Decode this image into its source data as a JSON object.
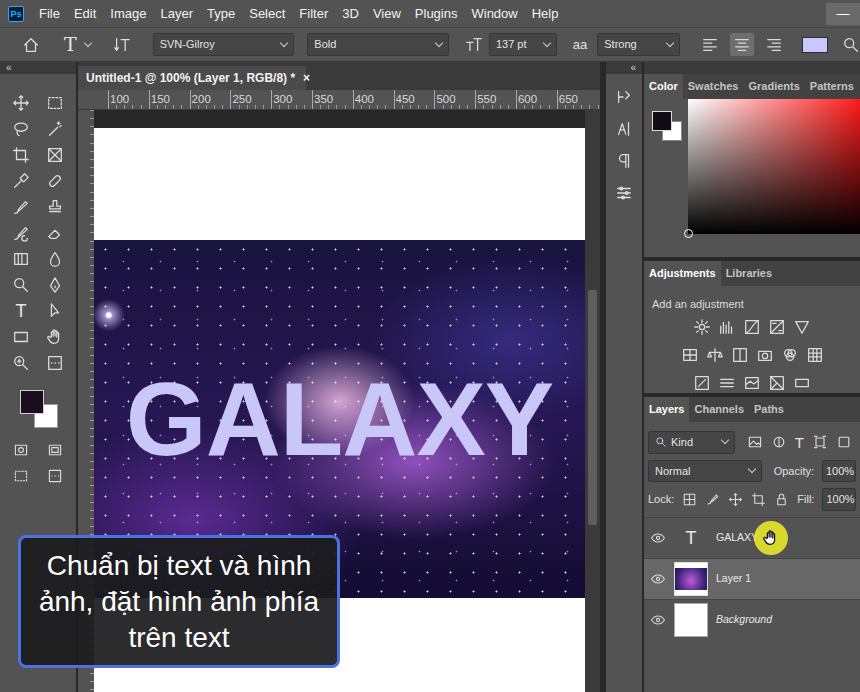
{
  "app": {
    "logo": "Ps"
  },
  "menu": [
    "File",
    "Edit",
    "Image",
    "Layer",
    "Type",
    "Select",
    "Filter",
    "3D",
    "View",
    "Plugins",
    "Window",
    "Help"
  ],
  "window_controls": [
    "—"
  ],
  "options": {
    "tool_glyph": "T",
    "font_family": "SVN-Gilroy",
    "font_style": "Bold",
    "font_size": "137 pt",
    "antialias_glyph": "aa",
    "antialias": "Strong",
    "align": [
      {
        "name": "left",
        "selected": false
      },
      {
        "name": "center",
        "selected": true
      },
      {
        "name": "right",
        "selected": false
      }
    ]
  },
  "tools": {
    "collapse": "«",
    "type_glyph": "T"
  },
  "document": {
    "tab": "Untitled-1 @ 100% (Layer 1, RGB/8) *",
    "close": "×",
    "ruler": [
      "100",
      "150",
      "200",
      "250",
      "300",
      "350",
      "400",
      "450",
      "500",
      "550",
      "600",
      "650"
    ],
    "canvas_text": "GALAXY"
  },
  "caption": "Chuẩn bị text và hình ảnh, đặt hình ảnh phía trên text",
  "dock": {
    "collapse": "«"
  },
  "color_panel": {
    "tabs": [
      {
        "label": "Color",
        "selected": true
      },
      {
        "label": "Swatches",
        "selected": false
      },
      {
        "label": "Gradients",
        "selected": false
      },
      {
        "label": "Patterns",
        "selected": false
      }
    ]
  },
  "adjustments_panel": {
    "tabs": [
      {
        "label": "Adjustments",
        "selected": true
      },
      {
        "label": "Libraries",
        "selected": false
      }
    ],
    "hint": "Add an adjustment"
  },
  "layers_panel": {
    "tabs": [
      {
        "label": "Layers",
        "selected": true
      },
      {
        "label": "Channels",
        "selected": false
      },
      {
        "label": "Paths",
        "selected": false
      }
    ],
    "filter": "Kind",
    "filter_glyph": "T",
    "blend_mode": "Normal",
    "opacity_label": "Opacity:",
    "opacity": "100%",
    "lock_label": "Lock:",
    "fill_label": "Fill:",
    "fill": "100%",
    "layers": [
      {
        "name": "GALAXY",
        "kind": "text",
        "glyph": "T",
        "visible": true,
        "selected": false
      },
      {
        "name": "Layer 1",
        "kind": "image",
        "glyph": "",
        "visible": true,
        "selected": true
      },
      {
        "name": "Background",
        "kind": "background",
        "glyph": "",
        "visible": true,
        "selected": false
      }
    ]
  }
}
